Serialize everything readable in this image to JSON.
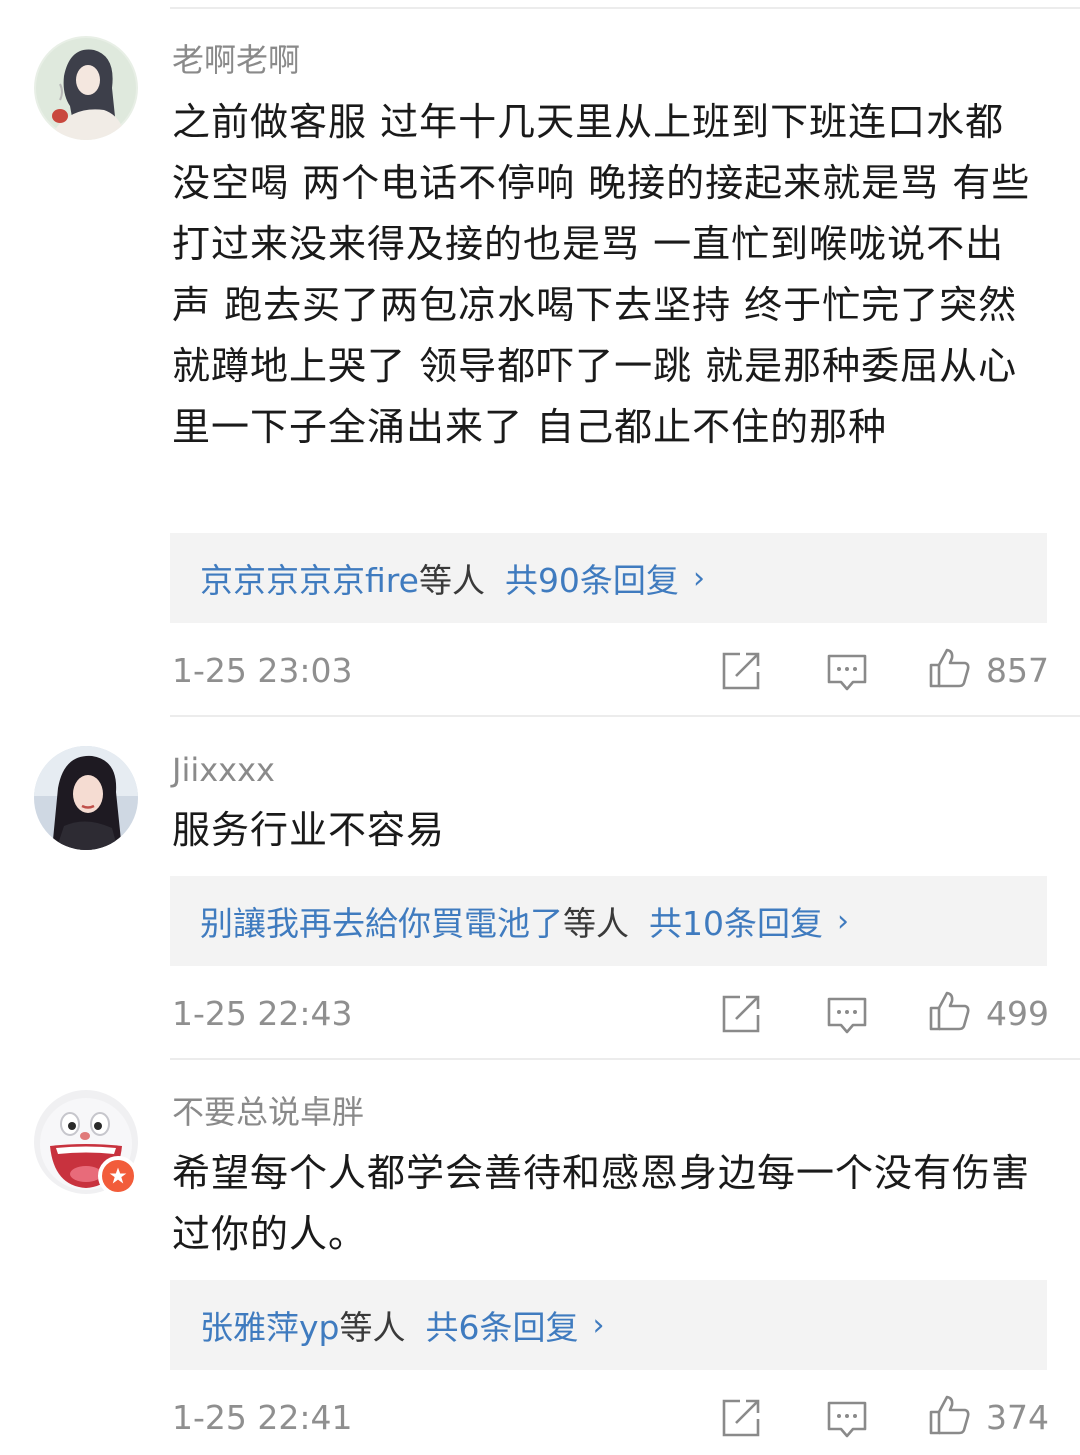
{
  "comments": [
    {
      "username": "老啊老啊",
      "content": "之前做客服  过年十几天里从上班到下班连口水都没空喝  两个电话不停响 晚接的接起来就是骂 有些打过来没来得及接的也是骂  一直忙到喉咙说不出声  跑去买了两包凉水喝下去坚持  终于忙完了突然就蹲地上哭了   领导都吓了一跳   就是那种委屈从心里一下子全涌出来了  自己都止不住的那种",
      "reply_names": "京京京京京fire",
      "reply_etc": "等人",
      "reply_count": "共90条回复",
      "time": "1-25 23:03",
      "likes": "857",
      "avatar_icon": "girl-portrait-avatar"
    },
    {
      "username": "Jiixxxx",
      "content": "服务行业不容易",
      "reply_names": "别讓我再去給你買電池了",
      "reply_etc": "等人",
      "reply_count": "共10条回复",
      "time": "1-25 22:43",
      "likes": "499",
      "avatar_icon": "girl-photo-avatar"
    },
    {
      "username": "不要总说卓胖",
      "content": "希望每个人都学会善待和感恩身边每一个没有伤害过你的人。",
      "reply_names": "张雅萍yp",
      "reply_etc": "等人",
      "reply_count": "共6条回复",
      "time": "1-25 22:41",
      "likes": "374",
      "avatar_icon": "cartoon-face-avatar"
    }
  ],
  "colors": {
    "link_blue": "#3f7bbf",
    "meta_gray": "#8f8f8f",
    "reply_bg": "#f3f3f3",
    "badge_orange": "#f25c3a"
  },
  "icons": [
    "repost-icon",
    "comment-icon",
    "thumbs-up-icon",
    "chevron-right-icon",
    "verified-badge-icon"
  ]
}
